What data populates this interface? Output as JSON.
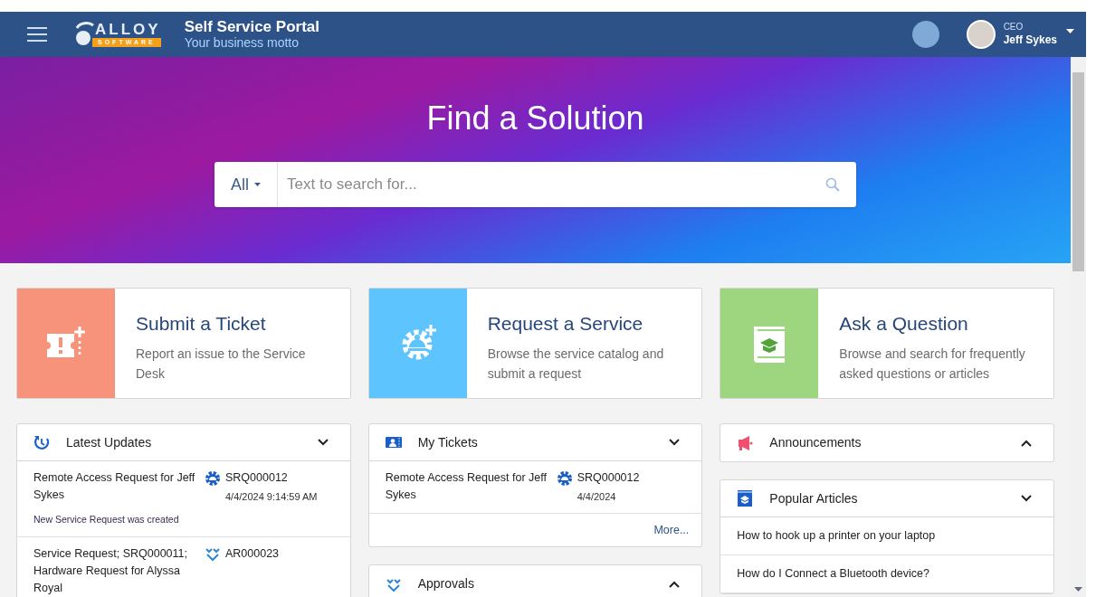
{
  "header": {
    "logo": {
      "word": "ALLOY",
      "subword": "SOFTWARE"
    },
    "title": "Self Service Portal",
    "motto": "Your business motto",
    "user": {
      "role": "CEO",
      "name": "Jeff Sykes"
    }
  },
  "hero": {
    "title": "Find a Solution",
    "search": {
      "scope": "All",
      "placeholder": "Text to search for..."
    }
  },
  "actions": [
    {
      "kind": "ticket",
      "title": "Submit a Ticket",
      "description": "Report an issue to the Service Desk",
      "color": "#f6937a"
    },
    {
      "kind": "service",
      "title": "Request a Service",
      "description": "Browse the service catalog and submit a request",
      "color": "#5ec4fd"
    },
    {
      "kind": "question",
      "title": "Ask a Question",
      "description": "Browse and search for frequently asked questions or articles",
      "color": "#9dd67f"
    }
  ],
  "columns": [
    [
      {
        "kind": "updates",
        "title": "Latest Updates",
        "expanded": true,
        "items": [
          {
            "kind": "service",
            "title": "Remote Access Request for Jeff Sykes",
            "id": "SRQ000012",
            "date": "4/4/2024 9:14:59 AM",
            "note": "New Service Request was created"
          },
          {
            "kind": "approval",
            "title": "Service Request; SRQ000011; Hardware Request for Alyssa Royal",
            "id": "AR000023"
          }
        ]
      }
    ],
    [
      {
        "kind": "tickets",
        "title": "My Tickets",
        "expanded": true,
        "items": [
          {
            "kind": "service",
            "title": "Remote Access Request for Jeff Sykes",
            "id": "SRQ000012",
            "date": "4/4/2024"
          }
        ],
        "more": "More..."
      },
      {
        "kind": "approvals",
        "title": "Approvals",
        "expanded": false
      }
    ],
    [
      {
        "kind": "announcements",
        "title": "Announcements",
        "expanded": false
      },
      {
        "kind": "articles",
        "title": "Popular Articles",
        "expanded": true,
        "links": [
          "How to hook up a printer on your laptop",
          "How do I Connect a Bluetooth device?"
        ]
      }
    ]
  ]
}
